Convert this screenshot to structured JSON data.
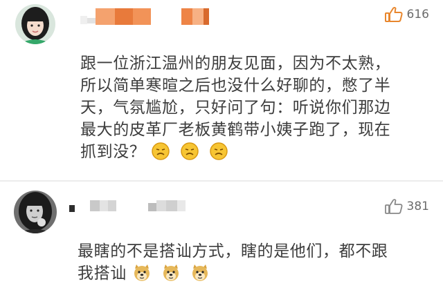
{
  "comments": [
    {
      "likes": "616",
      "text_lines": [
        "跟一位浙江温州的朋友见面，因为不太熟，",
        "所以简单寒暄之后也没什么好聊的，憋了半",
        "天，气氛尴尬，只好问了句：听说你们那边",
        "最大的皮革厂老板黄鹤带小姨子跑了，现在",
        "抓到没？"
      ],
      "emojis": [
        "lemon-face-emoji",
        "lemon-face-emoji",
        "lemon-face-emoji"
      ]
    },
    {
      "likes": "381",
      "text_lines": [
        "最瞎的不是搭讪方式，瞎的是他们，都不跟",
        "我搭讪"
      ],
      "emojis": [
        "doge-emoji",
        "doge-emoji",
        "doge-emoji"
      ]
    }
  ],
  "colors": {
    "like_icon": "#e8862c",
    "like_icon_2": "#888888",
    "text": "#3c3c3c",
    "count": "#6b6b6b",
    "mosaic_orange": "#f08a4b",
    "divider": "#ececec"
  }
}
